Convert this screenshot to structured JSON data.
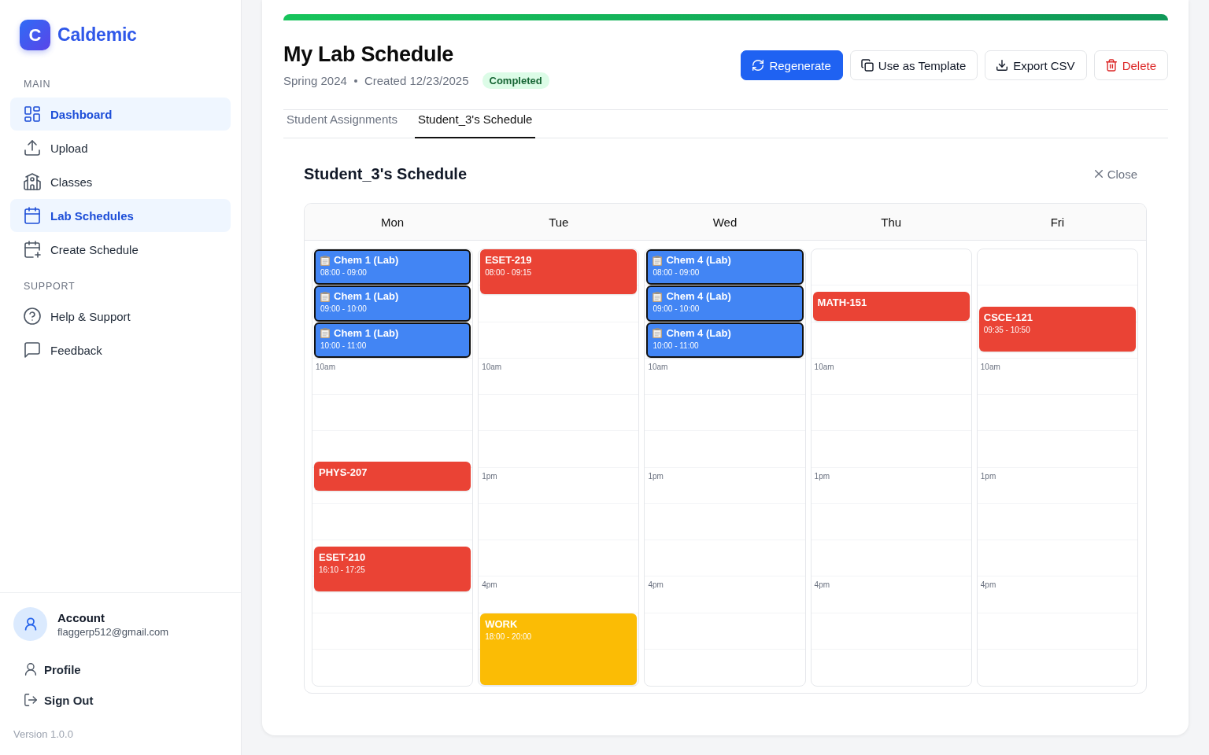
{
  "sidebar": {
    "logo": {
      "letter": "C",
      "name": "Caldemic"
    },
    "sections": [
      {
        "title": "MAIN",
        "items": [
          {
            "label": "Dashboard",
            "selected": true
          },
          {
            "label": "Upload",
            "selected": false
          },
          {
            "label": "Classes",
            "selected": false
          },
          {
            "label": "Lab Schedules",
            "selected": true
          },
          {
            "label": "Create Schedule",
            "selected": false
          }
        ]
      },
      {
        "title": "SUPPORT",
        "items": [
          {
            "label": "Help & Support",
            "selected": false
          },
          {
            "label": "Feedback",
            "selected": false
          }
        ]
      }
    ],
    "account": {
      "title": "Account",
      "email": "flaggerp512@gmail.com"
    },
    "account_links": [
      "Profile",
      "Sign Out"
    ],
    "version": "Version 1.0.0"
  },
  "header": {
    "title": "My Lab Schedule",
    "term": "Spring 2024",
    "created": "Created 12/23/2025",
    "status": "Completed",
    "buttons": [
      {
        "label": "Regenerate",
        "kind": "primary"
      },
      {
        "label": "Use as Template",
        "kind": "default"
      },
      {
        "label": "Export CSV",
        "kind": "default"
      },
      {
        "label": "Delete",
        "kind": "danger"
      }
    ]
  },
  "tabs": [
    {
      "label": "Student Assignments",
      "selected": false
    },
    {
      "label": "Student_3's Schedule",
      "selected": true
    }
  ],
  "schedule": {
    "title": "Student_3's Schedule",
    "close_label": "Close",
    "days": [
      {
        "name": "Mon",
        "hour_labels": [
          "10am"
        ],
        "events": [
          {
            "kind": "lab",
            "title": "Chem 1 (Lab)",
            "time": "08:00 - 09:00",
            "color": "#4285f4"
          },
          {
            "kind": "lab",
            "title": "Chem 1 (Lab)",
            "time": "09:00 - 10:00",
            "color": "#4285f4"
          },
          {
            "kind": "lab",
            "title": "Chem 1 (Lab)",
            "time": "10:00 - 11:00",
            "color": "#4285f4"
          },
          {
            "kind": "class",
            "title": "PHYS-207",
            "color": "#ea4335"
          },
          {
            "kind": "class",
            "title": "ESET-210",
            "time": "16:10 - 17:25",
            "color": "#ea4335"
          }
        ]
      },
      {
        "name": "Tue",
        "hour_labels": [
          "10am",
          "1pm",
          "4pm"
        ],
        "events": [
          {
            "kind": "class",
            "title": "ESET-219",
            "time": "08:00 - 09:15",
            "color": "#ea4335"
          },
          {
            "kind": "work",
            "title": "WORK",
            "time": "18:00 - 20:00",
            "color": "#fbbc05"
          }
        ]
      },
      {
        "name": "Wed",
        "hour_labels": [
          "10am",
          "1pm",
          "4pm"
        ],
        "events": [
          {
            "kind": "lab",
            "title": "Chem 4 (Lab)",
            "time": "08:00 - 09:00",
            "color": "#4285f4"
          },
          {
            "kind": "lab",
            "title": "Chem 4 (Lab)",
            "time": "09:00 - 10:00",
            "color": "#4285f4"
          },
          {
            "kind": "lab",
            "title": "Chem 4 (Lab)",
            "time": "10:00 - 11:00",
            "color": "#4285f4"
          }
        ]
      },
      {
        "name": "Thu",
        "hour_labels": [
          "10am",
          "1pm",
          "4pm"
        ],
        "events": [
          {
            "kind": "class",
            "title": "MATH-151",
            "color": "#ea4335"
          }
        ]
      },
      {
        "name": "Fri",
        "hour_labels": [
          "10am",
          "1pm",
          "4pm"
        ],
        "events": [
          {
            "kind": "class",
            "title": "CSCE-121",
            "time": "09:35 - 10:50",
            "color": "#ea4335"
          }
        ]
      }
    ]
  }
}
